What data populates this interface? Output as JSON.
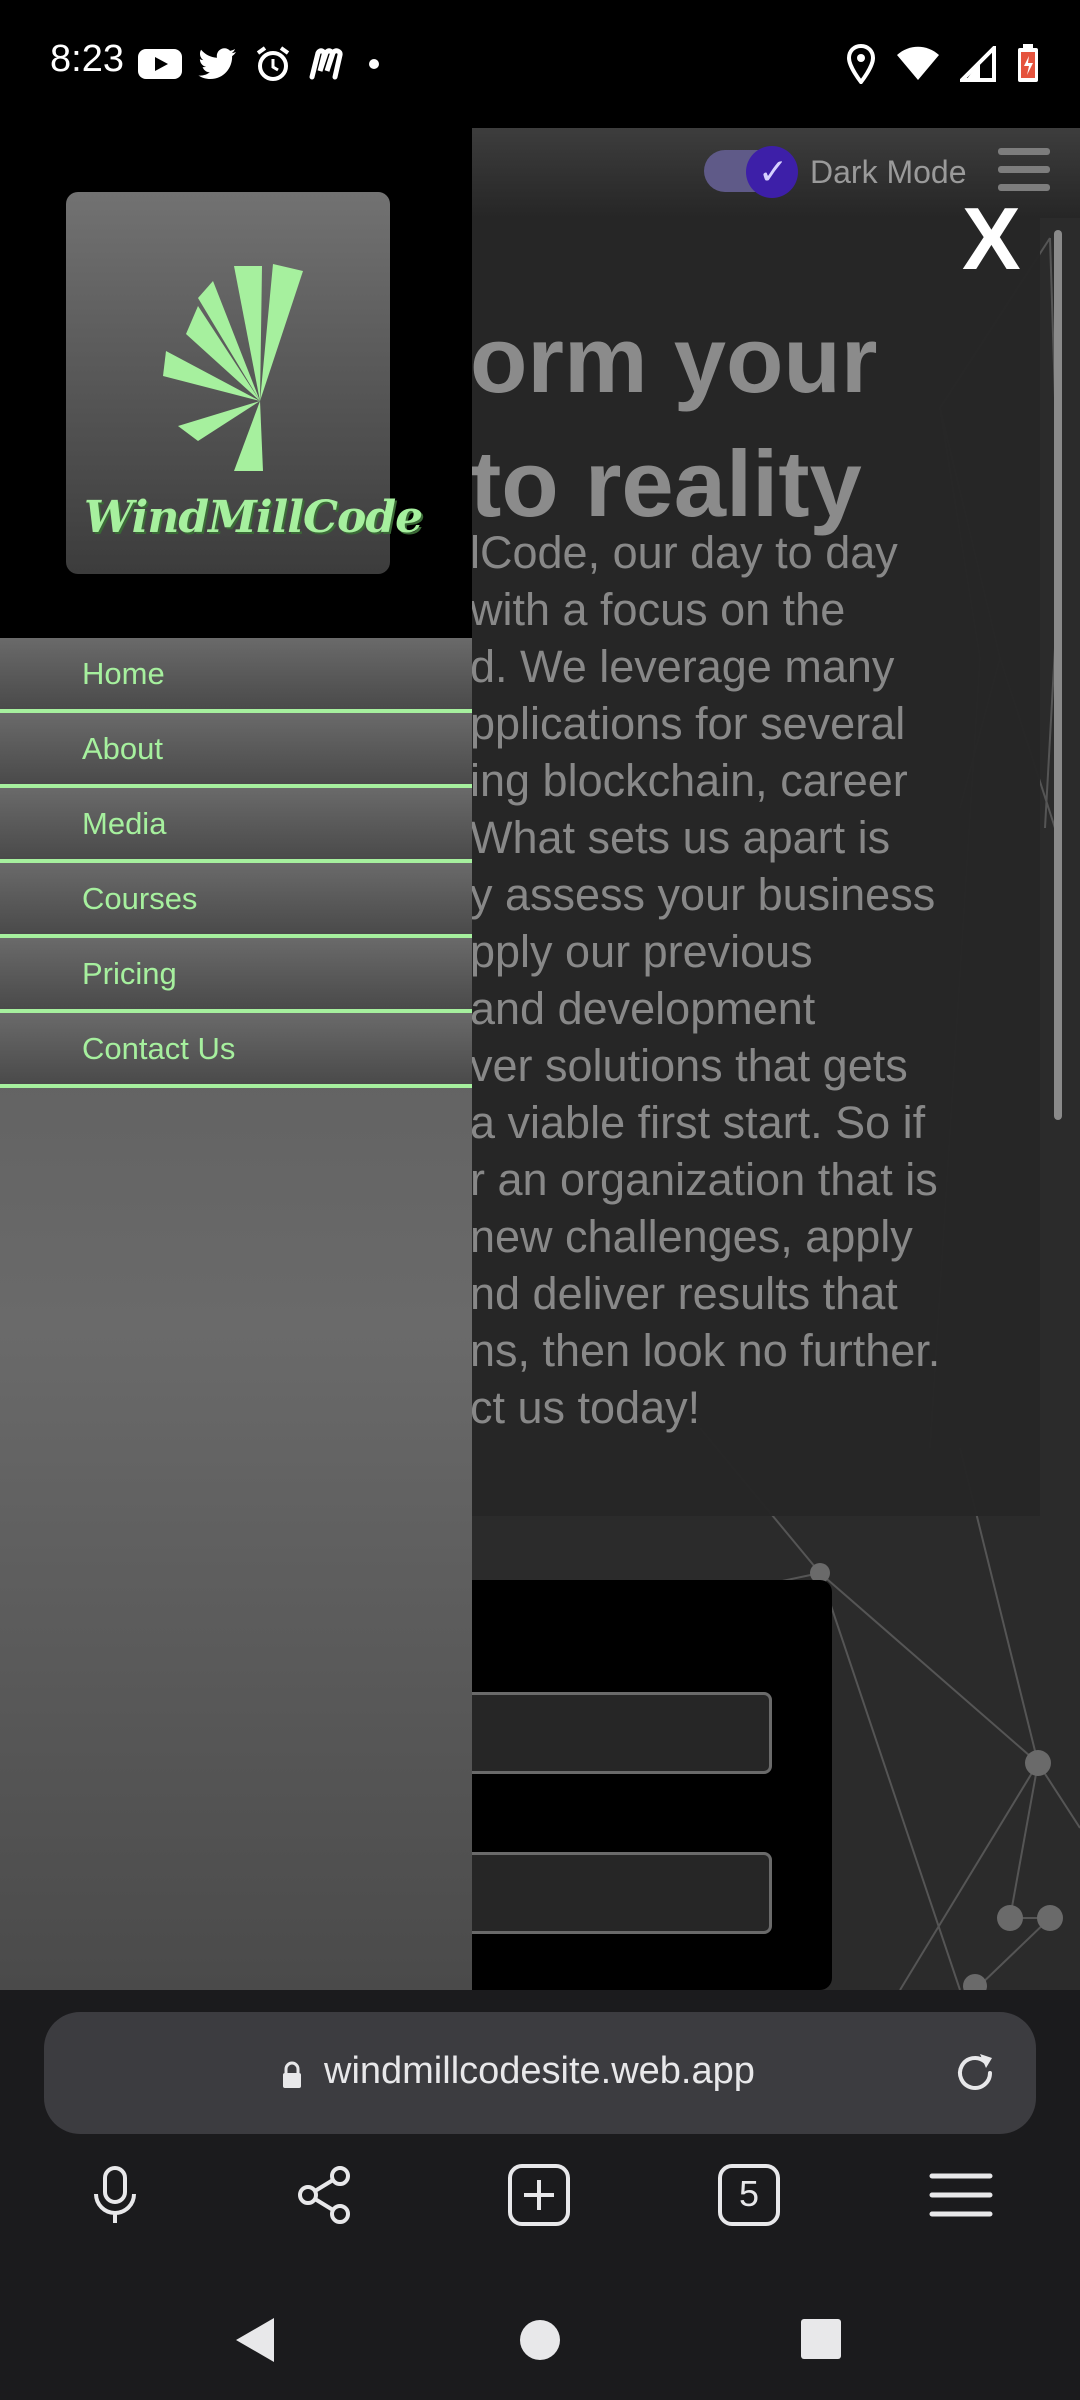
{
  "status_bar": {
    "time": "8:23",
    "left_icons": [
      "youtube-icon",
      "twitter-icon",
      "alarm-icon",
      "m-app-icon",
      "dot-icon"
    ],
    "right_icons": [
      "location-icon",
      "wifi-icon",
      "signal-icon",
      "battery-icon"
    ]
  },
  "header": {
    "dark_mode_label": "Dark Mode",
    "dark_mode_on": true,
    "close_label": "X"
  },
  "hero": {
    "title_lines": [
      "orm your",
      "to reality"
    ],
    "body_lines": [
      "lCode, our day to day",
      "with a focus on the",
      "d. We leverage many",
      "pplications for several",
      "ing blockchain, career",
      " What sets us apart is",
      "y assess your business",
      "pply our previous",
      " and development",
      "ver solutions that gets",
      "a viable first start. So if",
      "r an organization that is",
      "new challenges, apply",
      "nd deliver results that",
      "ns, then look no further.",
      "ct us today!"
    ]
  },
  "drawer": {
    "logo_text": "WindMillCode",
    "menu": [
      "Home",
      "About",
      "Media",
      "Courses",
      "Pricing",
      "Contact Us"
    ]
  },
  "browser": {
    "url": "windmillcodesite.web.app",
    "tab_count": "5"
  },
  "colors": {
    "accent_green": "#a6f09e",
    "toggle_knob": "#3d1fa8",
    "drawer_bg": "#5c5c5c"
  }
}
